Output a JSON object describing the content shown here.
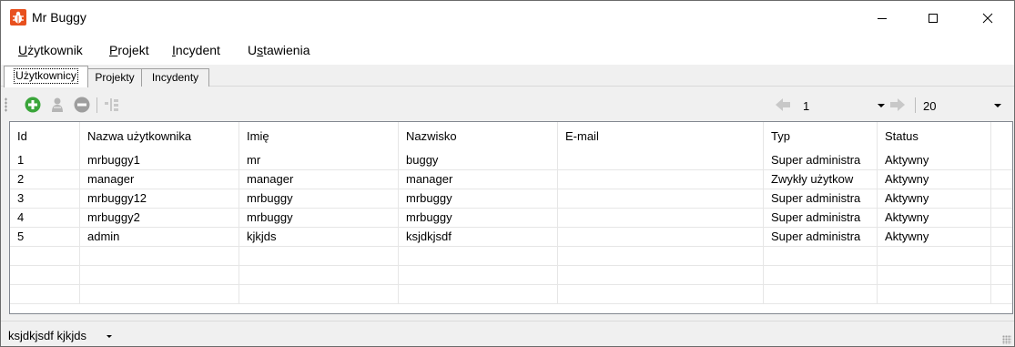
{
  "window": {
    "title": "Mr Buggy",
    "icon": "bug-app-icon",
    "controls": [
      "minimize-icon",
      "maximize-icon",
      "close-icon"
    ]
  },
  "menu": [
    {
      "label": "Użytkownik",
      "mnemonic": "U"
    },
    {
      "label": "Projekt",
      "mnemonic": "P"
    },
    {
      "label": "Incydent",
      "mnemonic": "I"
    },
    {
      "label": "Ustawienia",
      "mnemonic": "s"
    }
  ],
  "tabs": [
    {
      "label": "Użytkownicy",
      "active": true
    },
    {
      "label": "Projekty",
      "active": false
    },
    {
      "label": "Incydenty",
      "active": false
    }
  ],
  "toolbar": {
    "buttons": [
      "add-icon",
      "edit-user-icon",
      "remove-icon",
      "columns-icon"
    ],
    "page": "1",
    "page_size": "20",
    "prev_icon": "arrow-left-icon",
    "next_icon": "arrow-right-icon"
  },
  "table": {
    "columns": [
      "Id",
      "Nazwa użytkownika",
      "Imię",
      "Nazwisko",
      "E-mail",
      "Typ",
      "Status"
    ],
    "rows": [
      [
        "1",
        "mrbuggy1",
        "mr",
        "buggy",
        "",
        "Super administra",
        "Aktywny"
      ],
      [
        "2",
        "manager",
        "manager",
        "manager",
        "",
        "Zwykły użytkow",
        "Aktywny"
      ],
      [
        "3",
        "mrbuggy12",
        "mrbuggy",
        "mrbuggy",
        "",
        "Super administra",
        "Aktywny"
      ],
      [
        "4",
        "mrbuggy2",
        "mrbuggy",
        "mrbuggy",
        "",
        "Super administra",
        "Aktywny"
      ],
      [
        "5",
        "admin",
        "kjkjds",
        "ksjdkjsdf",
        "",
        "Super administra",
        "Aktywny"
      ]
    ]
  },
  "status": {
    "current_user": "ksjdkjsdf kjkjds"
  },
  "colors": {
    "add_green": "#3aa53a",
    "disabled_gray": "#9e9e9e",
    "icon_orange": "#e8501e"
  }
}
